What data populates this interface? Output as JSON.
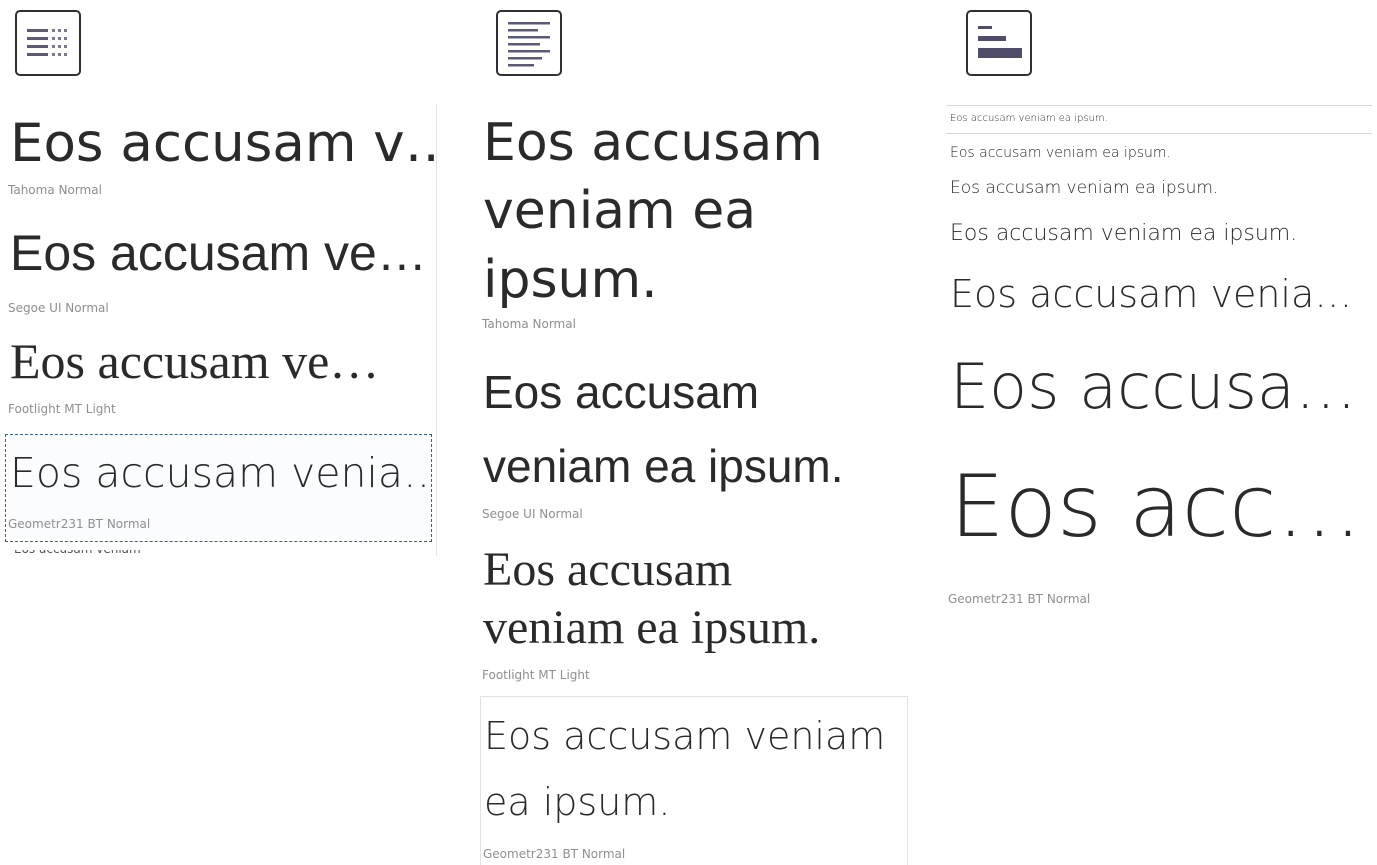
{
  "toolbar": {
    "buttons": [
      {
        "icon": "list-grid-view-icon"
      },
      {
        "icon": "multi-line-view-icon"
      },
      {
        "icon": "waterfall-view-icon"
      }
    ]
  },
  "single_line_view": {
    "items": [
      {
        "sample": "Eos accusam v…",
        "font": "Tahoma Normal"
      },
      {
        "sample": "Eos accusam ve…",
        "font": "Segoe UI Normal"
      },
      {
        "sample": "Eos accusam ve…",
        "font": "Footlight MT Light"
      },
      {
        "sample": "Eos accusam venia…",
        "font": "Geometr231 BT Normal",
        "selected": true
      }
    ]
  },
  "multi_line_view": {
    "items": [
      {
        "lines": [
          "Eos accusam",
          "veniam ea",
          "ipsum."
        ],
        "font": "Tahoma Normal"
      },
      {
        "lines": [
          "Eos accusam",
          "veniam ea ipsum."
        ],
        "font": "Segoe UI Normal"
      },
      {
        "lines": [
          "Eos accusam",
          "veniam ea ipsum."
        ],
        "font": "Footlight MT Light"
      },
      {
        "lines": [
          "Eos accusam veniam",
          "ea ipsum."
        ],
        "font": "Geometr231 BT Normal"
      }
    ]
  },
  "waterfall_view": {
    "samples": [
      "Eos accusam veniam ea ipsum.",
      "Eos accusam veniam ea ipsum.",
      "Eos accusam veniam ea ipsum.",
      "Eos accusam veniam ea ipsum.",
      "Eos accusam venia…",
      "Eos accusa…",
      "Eos acc…"
    ],
    "font": "Geometr231 BT Normal"
  }
}
